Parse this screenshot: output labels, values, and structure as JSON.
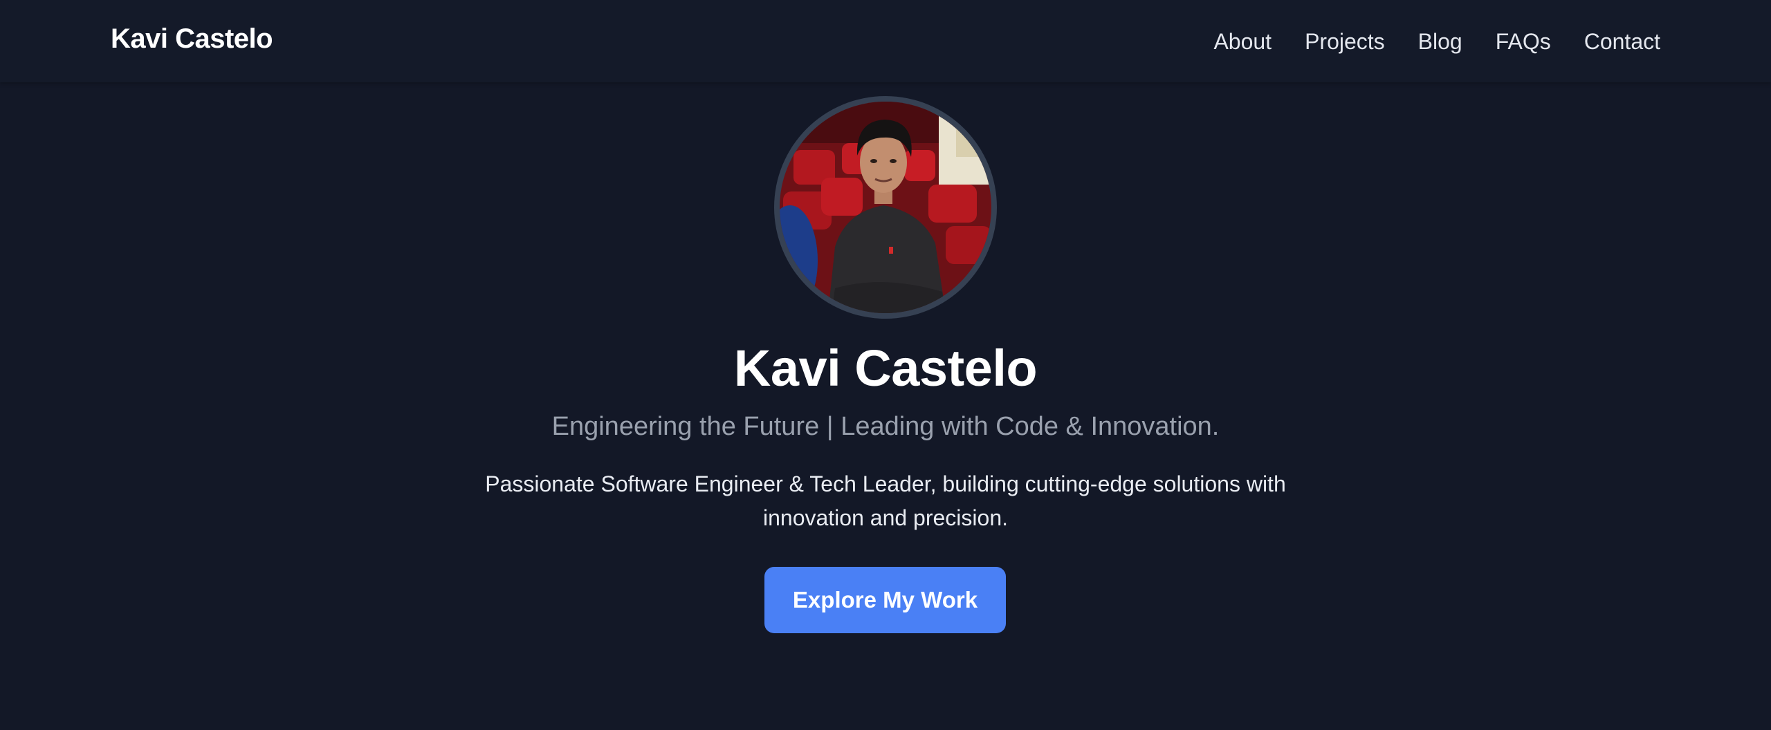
{
  "header": {
    "brand": "Kavi Castelo",
    "nav": [
      {
        "label": "About"
      },
      {
        "label": "Projects"
      },
      {
        "label": "Blog"
      },
      {
        "label": "FAQs"
      },
      {
        "label": "Contact"
      }
    ]
  },
  "hero": {
    "avatar_icon": "profile-photo",
    "name": "Kavi Castelo",
    "tagline": "Engineering the Future | Leading with Code & Innovation.",
    "description": "Passionate Software Engineer & Tech Leader, building cutting-edge solutions with innovation and precision.",
    "cta_label": "Explore My Work"
  },
  "colors": {
    "background": "#131827",
    "accent": "#4a80f5",
    "muted_text": "#9aa1ae"
  }
}
